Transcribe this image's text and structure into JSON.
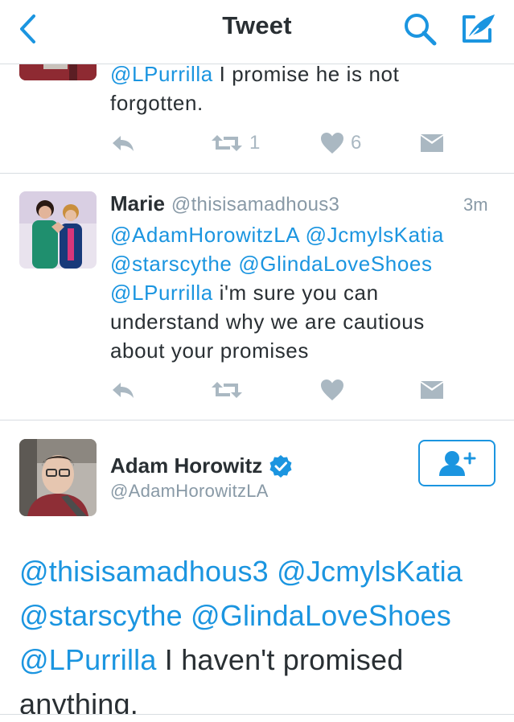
{
  "nav": {
    "title": "Tweet",
    "back_icon": "chevron-left-icon",
    "search_icon": "search-icon",
    "compose_icon": "compose-tweet-icon",
    "accent": "#1b95e0"
  },
  "tweets": [
    {
      "text_mention": "@LPurrilla",
      "text_rest": " I promise he is not",
      "text_line2": "forgotten.",
      "retweet_count": "1",
      "like_count": "6"
    },
    {
      "name": "Marie",
      "handle": "@thisisamadhous3",
      "time": "3m",
      "line1": [
        "@AdamHorowitzLA",
        " ",
        "@JcmylsKatia"
      ],
      "line2": [
        "@starscythe",
        " ",
        "@GlindaLoveShoes"
      ],
      "line3_mention": "@LPurrilla",
      "line3_rest": " i'm sure you can",
      "line4": "understand why we are cautious",
      "line5": "about your promises",
      "retweet_count": "",
      "like_count": ""
    }
  ],
  "focused": {
    "name": "Adam Horowitz",
    "handle": "@AdamHorowitzLA",
    "verified_icon": "verified-badge-icon",
    "follow_icon": "follow-user-icon",
    "line1": [
      "@thisisamadhous3",
      " ",
      "@JcmylsKatia"
    ],
    "line2": [
      "@starscythe",
      " ",
      "@GlindaLoveShoes"
    ],
    "line3_mention": "@LPurrilla",
    "line3_rest": " I haven't promised",
    "line4": "anything."
  },
  "colors": {
    "mention": "#1b95e0",
    "text": "#292f33",
    "muted": "#8899a6",
    "action": "#aab8c2"
  }
}
